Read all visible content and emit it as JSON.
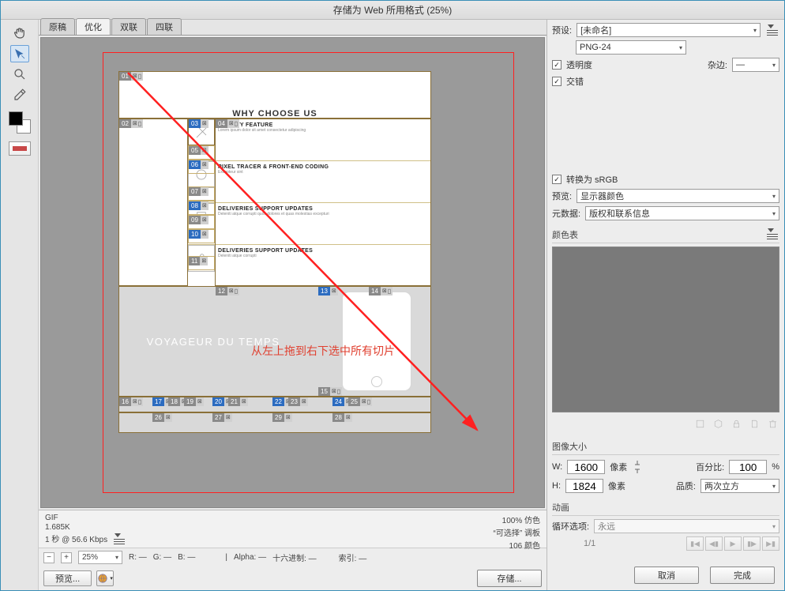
{
  "title": "存储为 Web 所用格式 (25%)",
  "tabs": {
    "t1": "原稿",
    "t2": "优化",
    "t3": "双联",
    "t4": "四联"
  },
  "canvas": {
    "heading": "WHY CHOOSE US",
    "voyage": "VOYAGEUR DU TEMPS",
    "annotation": "从左上拖到右下选中所有切片",
    "items": [
      {
        "h": "QUALITY FEATURE",
        "t": "Lorem ipsum dolor sit amet consectetur adipiscing"
      },
      {
        "h": "PIXEL TRACER & FRONT-END CODING",
        "t": "Excepteur sint"
      },
      {
        "h": "DELIVERIES SUPPORT UPDATES",
        "t": "Deleniti atque corrupti quos dolores et quas molestias excepturi"
      },
      {
        "h": "DELIVERIES SUPPORT UPDATES",
        "t": "Deleniti atque corrupti"
      }
    ]
  },
  "status": {
    "format": "GIF",
    "size": "1.685K",
    "time": "1 秒 @ 56.6 Kbps",
    "r1": "100% 仿色",
    "r2": "“可选择” 调板",
    "r3": "106 颜色"
  },
  "zoom": {
    "value": "25%",
    "r": "R: —",
    "g": "G: —",
    "b": "B: —",
    "alpha": "Alpha: —",
    "hex": "十六进制: —",
    "index": "索引: —"
  },
  "previewBtn": "预览...",
  "right": {
    "presetLabel": "预设:",
    "presetValue": "[未命名]",
    "formatValue": "PNG-24",
    "transparency": "透明度",
    "matteLabel": "杂边:",
    "matteValue": "—",
    "interlace": "交错",
    "convertSRGB": "转换为 sRGB",
    "previewLabel": "预览:",
    "previewValue": "显示器颜色",
    "metaLabel": "元数据:",
    "metaValue": "版权和联系信息",
    "colorTable": "颜色表",
    "imageSize": "图像大小",
    "wLabel": "W:",
    "wValue": "1600",
    "px": "像素",
    "hLabel": "H:",
    "hValue": "1824",
    "percentLabel": "百分比:",
    "percentValue": "100",
    "pctSym": "%",
    "qualityLabel": "品质:",
    "qualityValue": "两次立方",
    "anim": "动画",
    "loopLabel": "循环选项:",
    "loopValue": "永远",
    "pager": "1/1"
  },
  "buttons": {
    "save": "存储...",
    "cancel": "取消",
    "done": "完成"
  }
}
